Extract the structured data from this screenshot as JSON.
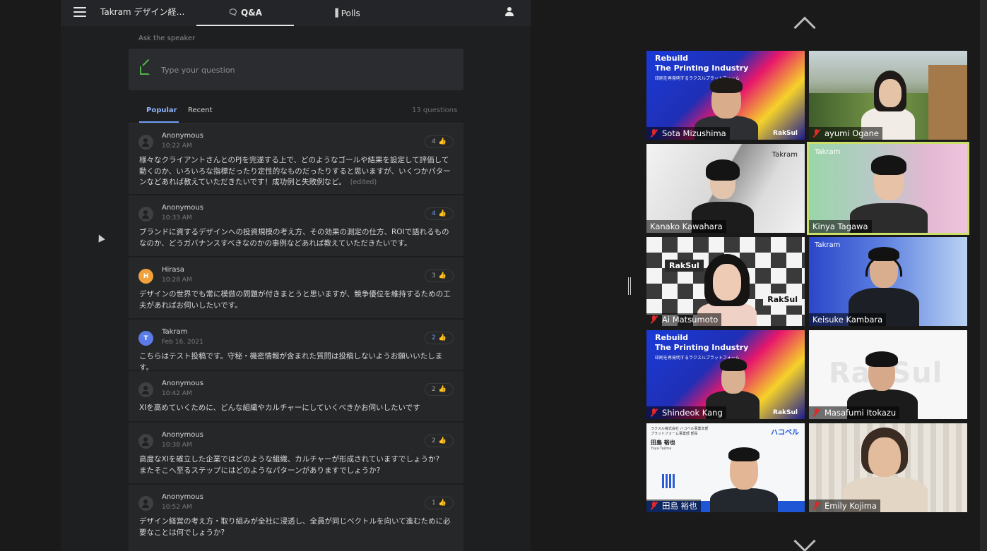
{
  "qa": {
    "event_title": "Takram デザイン経…",
    "tabs": {
      "qa": "Q&A",
      "polls": "Polls"
    },
    "ask_label": "Ask the speaker",
    "question_placeholder": "Type your question",
    "sort": {
      "popular": "Popular",
      "recent": "Recent"
    },
    "question_count": "13 questions",
    "questions": [
      {
        "author": "Anonymous",
        "initial": "",
        "avatar_color": "#3f4043",
        "time": "10:22 AM",
        "likes": "4",
        "liked": false,
        "text": "様々なクライアントさんとのPJを完遂する上で、どのようなゴールや結果を設定して評価して動くのか、いろいろな指標だったり定性的なものだったりすると思いますが、いくつかパターンなどあれば教えていただきたいです！成功例と失敗例など。",
        "edited": "(edited)"
      },
      {
        "author": "Anonymous",
        "initial": "",
        "avatar_color": "#3f4043",
        "time": "10:33 AM",
        "likes": "4",
        "liked": true,
        "text": "ブランドに資するデザインへの投資規模の考え方、その効果の測定の仕方、ROIで語れるものなのか、どうガバナンスすべきなのかの事例などあれば教えていただきたいです。",
        "edited": ""
      },
      {
        "author": "Hirasa",
        "initial": "H",
        "avatar_color": "#f0a13c",
        "time": "10:28 AM",
        "likes": "3",
        "liked": false,
        "text": "デザインの世界でも常に模倣の問題が付きまとうと思いますが、競争優位を維持するための工夫があればお伺いしたいです。",
        "edited": ""
      },
      {
        "author": "Takram",
        "initial": "T",
        "avatar_color": "#5b7be8",
        "time": "Feb 16, 2021",
        "likes": "2",
        "liked": true,
        "text": "こちらはテスト投稿です。守秘・機密情報が含まれた質問は投稿しないようお願いいたします。",
        "edited": ""
      },
      {
        "author": "Anonymous",
        "initial": "",
        "avatar_color": "#3f4043",
        "time": "10:42 AM",
        "likes": "2",
        "liked": false,
        "text": "XIを高めていくために、どんな組織やカルチャーにしていくべきかお伺いしたいです",
        "edited": ""
      },
      {
        "author": "Anonymous",
        "initial": "",
        "avatar_color": "#3f4043",
        "time": "10:38 AM",
        "likes": "2",
        "liked": false,
        "text": "高度なXIを確立した企業ではどのような組織、カルチャーが形成されていますでしょうか?\nまたそこへ至るステップにはどのようなパターンがありますでしょうか?",
        "edited": ""
      },
      {
        "author": "Anonymous",
        "initial": "",
        "avatar_color": "#3f4043",
        "time": "10:52 AM",
        "likes": "1",
        "liked": false,
        "text": "デザイン経営の考え方・取り組みが全社に浸透し、全員が同じベクトルを向いて進むために必要なことは何でしょうか?",
        "edited": ""
      }
    ]
  },
  "gallery": {
    "active_color": "#c9df6a",
    "banner_title": [
      "Rebuild",
      "The Printing Industry"
    ],
    "banner_sub": "印刷を再発明するラクスルプラットフォーム",
    "takram_label": "Takram",
    "raksul_label": "RakSul",
    "card": {
      "company": "ラクスル株式会社 ハコベル事業本部",
      "dept": "プラットフォーム事業部 部長",
      "name_jp": "田島 裕也",
      "name_en": "Yuya Tajima",
      "brand": "ハコベル"
    },
    "participants": [
      {
        "name": "Sota Mizushima",
        "muted": true
      },
      {
        "name": "ayumi Ogane",
        "muted": true
      },
      {
        "name": "Kanako Kawahara",
        "muted": false
      },
      {
        "name": "Kinya Tagawa",
        "muted": false,
        "active": true
      },
      {
        "name": "Ai Matsumoto",
        "muted": true
      },
      {
        "name": "Keisuke Kambara",
        "muted": false
      },
      {
        "name": "Shindeok Kang",
        "muted": true
      },
      {
        "name": "Masafumi Itokazu",
        "muted": true
      },
      {
        "name": "田島 裕也",
        "muted": true
      },
      {
        "name": "Emily Kojima",
        "muted": true
      }
    ]
  }
}
